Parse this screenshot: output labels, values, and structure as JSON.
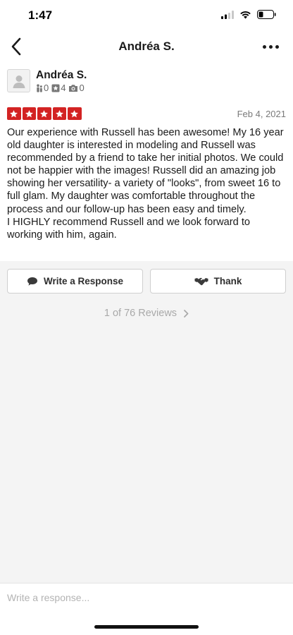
{
  "status_bar": {
    "time": "1:47"
  },
  "nav": {
    "title": "Andréa S."
  },
  "review": {
    "user_name": "Andréa S.",
    "stats": {
      "friends": "0",
      "reviews": "4",
      "photos": "0"
    },
    "rating": 5,
    "date": "Feb 4, 2021",
    "text": "Our experience with Russell has been awesome! My 16 year old daughter is interested in modeling and Russell was recommended by a friend to take her initial photos. We could not be happier with the images! Russell did an amazing job showing her versatility- a variety of \"looks\", from sweet 16 to full glam. My daughter was comfortable throughout the process and our follow-up has been easy and timely.\nI HIGHLY recommend Russell and we look forward to working with him, again."
  },
  "actions": {
    "write_response": "Write a Response",
    "thank": "Thank"
  },
  "pager": {
    "label": "1 of 76 Reviews"
  },
  "compose": {
    "placeholder": "Write a response..."
  },
  "colors": {
    "star_red": "#d32323",
    "background": "#f4f4f4"
  },
  "icons": [
    "back-arrow-icon",
    "more-icon",
    "friends-icon",
    "review-icon",
    "camera-icon",
    "star-icon",
    "speech-bubble-icon",
    "handshake-icon",
    "chevron-right-icon"
  ]
}
